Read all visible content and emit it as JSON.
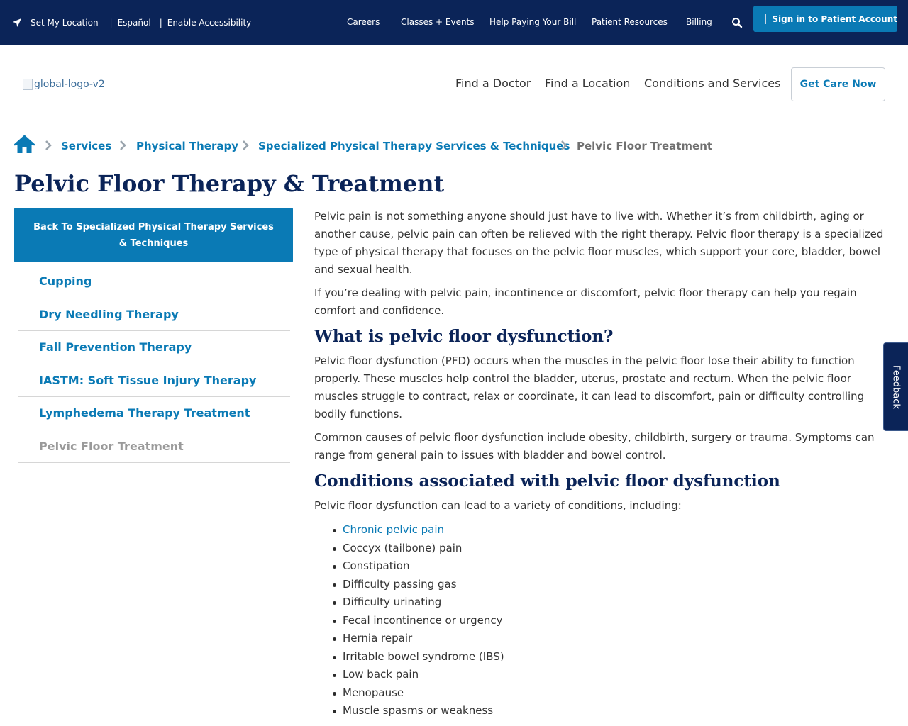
{
  "utility_bar": {
    "set_location": "Set My Location",
    "separator": "|",
    "espanol": "Español",
    "accessibility": "Enable Accessibility",
    "nav": [
      "Careers",
      "Classes + Events",
      "Help Paying Your Bill",
      "Patient Resources",
      "Billing"
    ],
    "sign_in": "Sign in to Patient Account",
    "icons": {
      "location": "location-arrow-icon",
      "search": "search-icon"
    }
  },
  "header": {
    "logo_alt": "global-logo-v2",
    "nav": [
      "Find a Doctor",
      "Find a Location",
      "Conditions and Services"
    ],
    "get_care": "Get Care Now"
  },
  "breadcrumb": {
    "home_icon": "home-icon",
    "items": [
      "Services",
      "Physical Therapy",
      "Specialized Physical Therapy Services & Techniques"
    ],
    "current": "Pelvic Floor Treatment"
  },
  "page": {
    "title": "Pelvic Floor Therapy & Treatment"
  },
  "sidebar": {
    "back_label": "Back To Specialized Physical Therapy Services & Techniques",
    "items": [
      {
        "label": "Cupping"
      },
      {
        "label": "Dry Needling Therapy"
      },
      {
        "label": "Fall Prevention Therapy"
      },
      {
        "label": "IASTM: Soft Tissue Injury Therapy"
      },
      {
        "label": "Lymphedema Therapy Treatment"
      },
      {
        "label": "Pelvic Floor Treatment"
      }
    ]
  },
  "content": {
    "intro_1": "Pelvic pain is not something anyone should just have to live with. Whether it’s from childbirth, aging or another cause, pelvic pain can often be relieved with the right therapy. Pelvic floor therapy is a specialized type of physical therapy that focuses on the pelvic floor muscles, which support your core, bladder, bowel and sexual health.",
    "intro_2": "If you’re dealing with pelvic pain, incontinence or discomfort, pelvic floor therapy can help you regain comfort and confidence.",
    "h2_1": "What is pelvic floor dysfunction?",
    "pfd_1": "Pelvic floor dysfunction (PFD) occurs when the muscles in the pelvic floor lose their ability to function properly. These muscles help control the bladder, uterus, prostate and rectum. When the pelvic floor muscles struggle to contract, relax or coordinate, it can lead to discomfort, pain or difficulty controlling bodily functions.",
    "pfd_2": "Common causes of pelvic floor dysfunction include obesity, childbirth, surgery or trauma. Symptoms can range from general pain to issues with bladder and bowel control.",
    "h2_2": "Conditions associated with pelvic floor dysfunction",
    "conditions_intro": "Pelvic floor dysfunction can lead to a variety of conditions, including:",
    "conditions": [
      "Chronic pelvic pain",
      "Coccyx (tailbone) pain",
      "Constipation",
      "Difficulty passing gas",
      "Difficulty urinating",
      "Fecal incontinence or urgency",
      "Hernia repair",
      "Irritable bowel syndrome (IBS)",
      "Low back pain",
      "Menopause",
      "Muscle spasms or weakness"
    ]
  },
  "feedback": {
    "label": "Feedback"
  },
  "colors": {
    "navy": "#0b2458",
    "brand_blue": "#0a7ab5",
    "text": "#333333",
    "muted": "#9a9a9a"
  }
}
